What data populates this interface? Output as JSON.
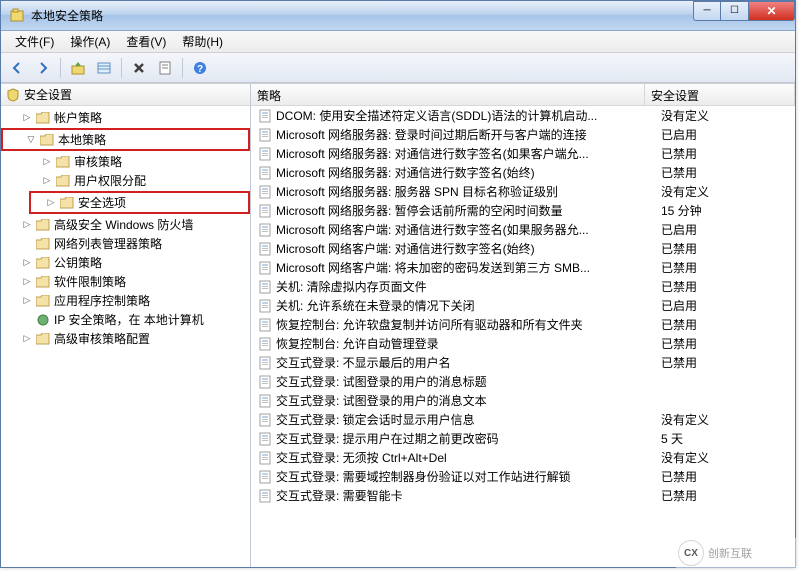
{
  "window": {
    "title": "本地安全策略"
  },
  "menu": {
    "file": "文件(F)",
    "action": "操作(A)",
    "view": "查看(V)",
    "help": "帮助(H)"
  },
  "tree": {
    "root": "安全设置",
    "accountPolicy": "帐户策略",
    "localPolicy": "本地策略",
    "auditPolicy": "审核策略",
    "userRights": "用户权限分配",
    "securityOptions": "安全选项",
    "firewall": "高级安全 Windows 防火墙",
    "netListMgr": "网络列表管理器策略",
    "publicKey": "公钥策略",
    "softwareRestrict": "软件限制策略",
    "appControl": "应用程序控制策略",
    "ipsec": "IP 安全策略，在 本地计算机",
    "advAudit": "高级审核策略配置"
  },
  "listHeader": {
    "policy": "策略",
    "setting": "安全设置"
  },
  "policies": [
    {
      "name": "DCOM: 使用安全描述符定义语言(SDDL)语法的计算机启动...",
      "setting": "没有定义"
    },
    {
      "name": "Microsoft 网络服务器: 登录时间过期后断开与客户端的连接",
      "setting": "已启用"
    },
    {
      "name": "Microsoft 网络服务器: 对通信进行数字签名(如果客户端允...",
      "setting": "已禁用"
    },
    {
      "name": "Microsoft 网络服务器: 对通信进行数字签名(始终)",
      "setting": "已禁用"
    },
    {
      "name": "Microsoft 网络服务器: 服务器 SPN 目标名称验证级别",
      "setting": "没有定义"
    },
    {
      "name": "Microsoft 网络服务器: 暂停会话前所需的空闲时间数量",
      "setting": "15 分钟"
    },
    {
      "name": "Microsoft 网络客户端: 对通信进行数字签名(如果服务器允...",
      "setting": "已启用"
    },
    {
      "name": "Microsoft 网络客户端: 对通信进行数字签名(始终)",
      "setting": "已禁用"
    },
    {
      "name": "Microsoft 网络客户端: 将未加密的密码发送到第三方 SMB...",
      "setting": "已禁用"
    },
    {
      "name": "关机: 清除虚拟内存页面文件",
      "setting": "已禁用"
    },
    {
      "name": "关机: 允许系统在未登录的情况下关闭",
      "setting": "已启用"
    },
    {
      "name": "恢复控制台: 允许软盘复制并访问所有驱动器和所有文件夹",
      "setting": "已禁用"
    },
    {
      "name": "恢复控制台: 允许自动管理登录",
      "setting": "已禁用"
    },
    {
      "name": "交互式登录: 不显示最后的用户名",
      "setting": "已禁用"
    },
    {
      "name": "交互式登录: 试图登录的用户的消息标题",
      "setting": ""
    },
    {
      "name": "交互式登录: 试图登录的用户的消息文本",
      "setting": ""
    },
    {
      "name": "交互式登录: 锁定会话时显示用户信息",
      "setting": "没有定义"
    },
    {
      "name": "交互式登录: 提示用户在过期之前更改密码",
      "setting": "5 天"
    },
    {
      "name": "交互式登录: 无须按 Ctrl+Alt+Del",
      "setting": "没有定义"
    },
    {
      "name": "交互式登录: 需要域控制器身份验证以对工作站进行解锁",
      "setting": "已禁用"
    },
    {
      "name": "交互式登录: 需要智能卡",
      "setting": "已禁用"
    }
  ],
  "watermark": {
    "label": "创新互联",
    "logo": "CX"
  }
}
